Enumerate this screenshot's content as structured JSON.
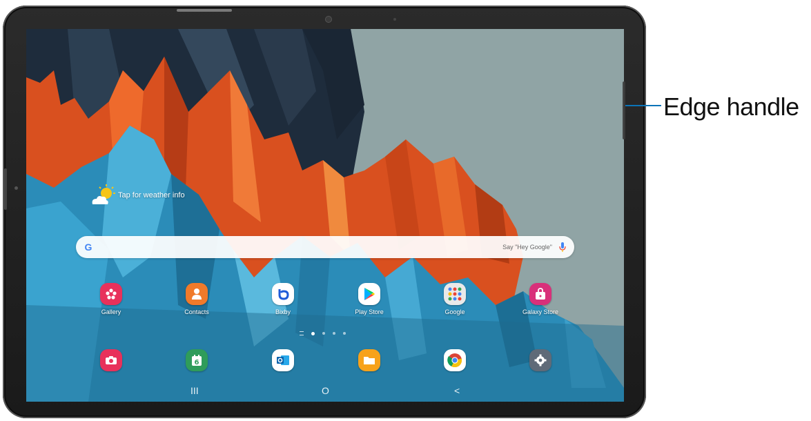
{
  "callout": {
    "label": "Edge handle"
  },
  "weather": {
    "text": "Tap for weather info"
  },
  "search": {
    "hint": "Say \"Hey Google\"",
    "logo": "G"
  },
  "apps_row1": [
    {
      "label": "Gallery",
      "icon": "gallery-icon",
      "color": "#e8315b"
    },
    {
      "label": "Contacts",
      "icon": "contacts-icon",
      "color": "#f07a2a"
    },
    {
      "label": "Bixby",
      "icon": "bixby-icon",
      "color": "#ffffff"
    },
    {
      "label": "Play Store",
      "icon": "play-store-icon",
      "color": "#ffffff"
    },
    {
      "label": "Google",
      "icon": "google-folder-icon",
      "color": "#e9e9e9"
    },
    {
      "label": "Galaxy Store",
      "icon": "galaxy-store-icon",
      "color": "#d9307a"
    }
  ],
  "apps_row2": [
    {
      "icon": "camera-icon",
      "color": "#e8315b"
    },
    {
      "icon": "calendar-icon",
      "color": "#2f9c5a",
      "text": "6"
    },
    {
      "icon": "outlook-icon",
      "color": "#ffffff"
    },
    {
      "icon": "my-files-icon",
      "color": "#f7a21b"
    },
    {
      "icon": "chrome-icon",
      "color": "#ffffff"
    },
    {
      "icon": "settings-icon",
      "color": "#5f6a78"
    }
  ],
  "pager": {
    "pages": 4,
    "active": 1
  },
  "navbar": {
    "recents": "III",
    "home": "O",
    "back": "<"
  }
}
